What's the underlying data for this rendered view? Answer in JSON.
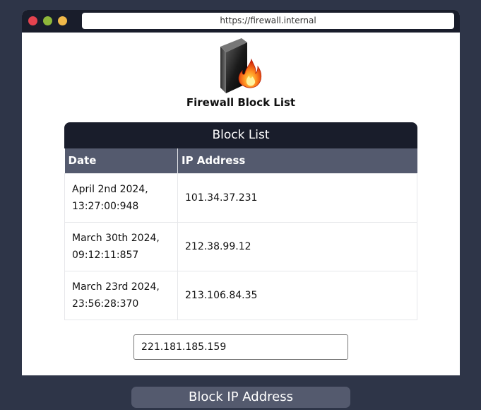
{
  "browser": {
    "url": "https://firewall.internal"
  },
  "app": {
    "title": "Firewall Block List"
  },
  "block_list": {
    "header": "Block List",
    "columns": [
      "Date",
      "IP Address"
    ],
    "rows": [
      {
        "date_line1": "April 2nd 2024,",
        "date_line2": "13:27:00:948",
        "ip": "101.34.37.231"
      },
      {
        "date_line1": "March 30th 2024,",
        "date_line2": "09:12:11:857",
        "ip": "212.38.99.12"
      },
      {
        "date_line1": "March 23rd 2024,",
        "date_line2": "23:56:28:370",
        "ip": "213.106.84.35"
      }
    ]
  },
  "form": {
    "ip_input_value": "221.181.185.159",
    "submit_label": "Block IP Address"
  },
  "icons": {
    "logo": "firewall-icon"
  },
  "colors": {
    "dark": "#191d2b",
    "accent": "#545a6e",
    "background": "#2e3548"
  }
}
